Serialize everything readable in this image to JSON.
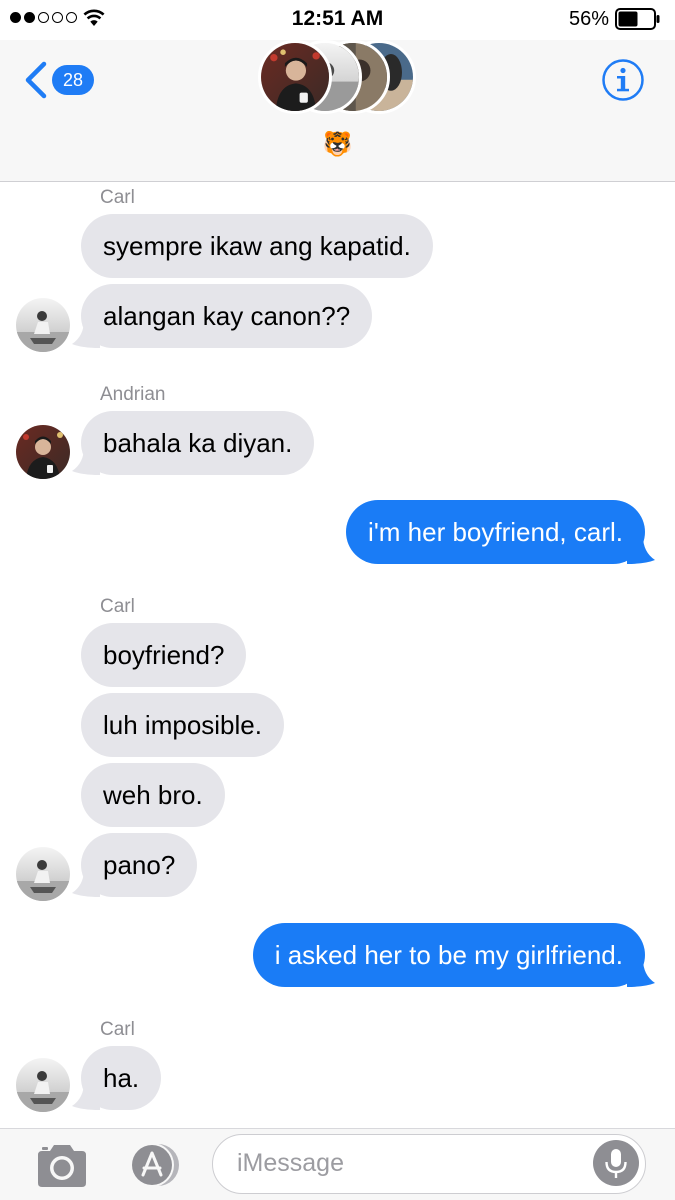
{
  "status_bar": {
    "time": "12:51 AM",
    "battery_percent": "56%",
    "signal_bars_filled": 2,
    "signal_bars_total": 5,
    "battery_level": 0.56
  },
  "header": {
    "back_badge": "28",
    "group_emoji": "🐯",
    "info_icon": "info-icon"
  },
  "messages": [
    {
      "sender": "Carl"
    },
    {
      "text": "syempre ikaw ang kapatid."
    },
    {
      "text": "alangan kay canon??"
    },
    {
      "sender": "Andrian"
    },
    {
      "text": "bahala ka diyan."
    },
    {
      "text": "i'm her boyfriend, carl."
    },
    {
      "sender": "Carl"
    },
    {
      "text": "boyfriend?"
    },
    {
      "text": "luh imposible."
    },
    {
      "text": "weh bro."
    },
    {
      "text": "pano?"
    },
    {
      "text": "i asked her to be my girlfriend."
    },
    {
      "sender": "Carl"
    },
    {
      "text": "ha."
    }
  ],
  "input_bar": {
    "placeholder": "iMessage",
    "value": ""
  },
  "colors": {
    "incoming_bubble": "#e5e5ea",
    "outgoing_bubble": "#1a7cf6",
    "accent": "#1f7cf5",
    "sender_label": "#8e8e93"
  }
}
